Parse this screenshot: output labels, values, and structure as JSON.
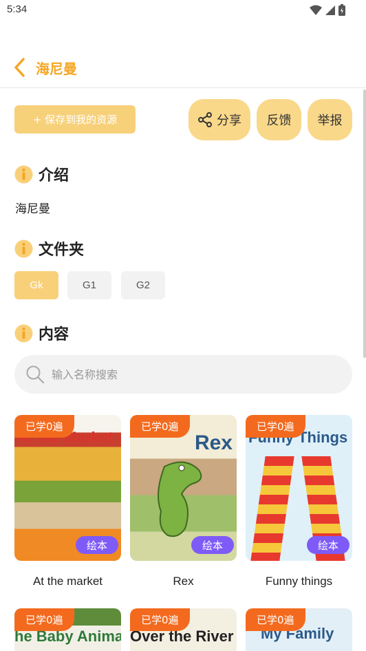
{
  "status_bar": {
    "time": "5:34"
  },
  "header": {
    "title": "海尼曼"
  },
  "actions": {
    "save": "+ 保存到我的资源",
    "share": "分享",
    "feedback": "反馈",
    "report": "举报"
  },
  "intro": {
    "title": "介绍",
    "text": "海尼曼"
  },
  "folders": {
    "title": "文件夹",
    "items": [
      "Gk",
      "G1",
      "G2"
    ],
    "selected": "Gk"
  },
  "content": {
    "title": "内容",
    "search_placeholder": "输入名称搜索",
    "items": [
      {
        "label": "At the market",
        "cover_title": "At the Market",
        "learned": "已学0遍",
        "type": "绘本"
      },
      {
        "label": "Rex",
        "cover_title": "Rex",
        "learned": "已学0遍",
        "type": "绘本"
      },
      {
        "label": "Funny things",
        "cover_title": "Funny Things",
        "learned": "已学0遍",
        "type": "绘本"
      },
      {
        "label": "",
        "cover_title": "he Baby Anima",
        "learned": "已学0遍",
        "type": ""
      },
      {
        "label": "",
        "cover_title": "Over the River",
        "learned": "已学0遍",
        "type": ""
      },
      {
        "label": "",
        "cover_title": "My Family",
        "learned": "已学0遍",
        "type": ""
      }
    ]
  },
  "colors": {
    "accent": "#f5a623",
    "button": "#f9d88a",
    "learned_tag": "#f36a1e",
    "type_tag": "#7e5bf6"
  }
}
